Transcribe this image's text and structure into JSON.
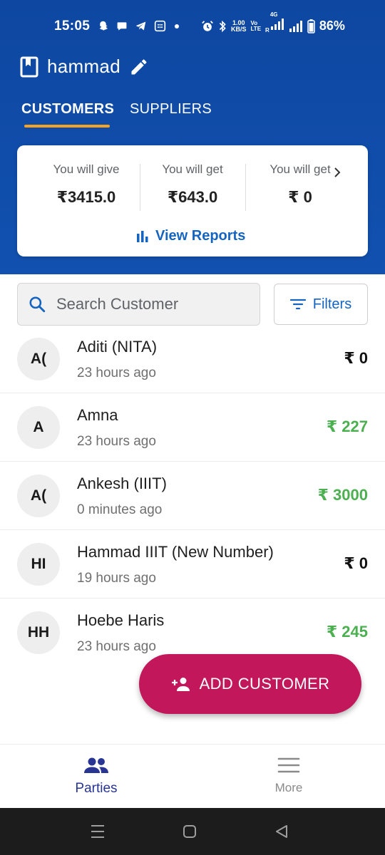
{
  "status_bar": {
    "time": "15:05",
    "network_speed_value": "1.00",
    "network_speed_unit": "KB/S",
    "volte_top": "Vo",
    "volte_bottom": "LTE",
    "net_type": "4G",
    "roaming": "R",
    "battery": "86%"
  },
  "header": {
    "book_name": "hammad",
    "tabs": [
      {
        "label": "CUSTOMERS",
        "active": true
      },
      {
        "label": "SUPPLIERS",
        "active": false
      }
    ],
    "accent_color": "#0d47a1",
    "tab_indicator_color": "#f4a21f"
  },
  "summary": {
    "items": [
      {
        "label": "You will give",
        "value": "₹3415.0"
      },
      {
        "label": "You will get",
        "value": "₹643.0"
      },
      {
        "label": "You will get",
        "value": "₹ 0"
      }
    ],
    "view_reports_label": "View Reports"
  },
  "search": {
    "placeholder": "Search Customer",
    "value": "",
    "filters_label": "Filters"
  },
  "customers": [
    {
      "initials": "A(",
      "name": "Aditi (NITA)",
      "time": "23 hours ago",
      "amount": "₹ 0",
      "amount_color": "#111111"
    },
    {
      "initials": "A",
      "name": "Amna",
      "time": "23 hours ago",
      "amount": "₹ 227",
      "amount_color": "#4caf50"
    },
    {
      "initials": "A(",
      "name": "Ankesh (IIIT)",
      "time": "0 minutes ago",
      "amount": "₹ 3000",
      "amount_color": "#4caf50"
    },
    {
      "initials": "HI",
      "name": "Hammad IIIT (New Number)",
      "time": "19 hours ago",
      "amount": "₹ 0",
      "amount_color": "#111111"
    },
    {
      "initials": "HH",
      "name": "Hoebe Haris",
      "time": "23 hours ago",
      "amount": "₹ 245",
      "amount_color": "#4caf50"
    }
  ],
  "fab": {
    "label": "ADD CUSTOMER",
    "color": "#c2185b"
  },
  "bottom_nav": {
    "items": [
      {
        "label": "Parties",
        "icon": "people-icon",
        "active": true
      },
      {
        "label": "More",
        "icon": "menu-icon",
        "active": false
      }
    ],
    "active_color": "#283593",
    "inactive_color": "#8a8a8a"
  }
}
